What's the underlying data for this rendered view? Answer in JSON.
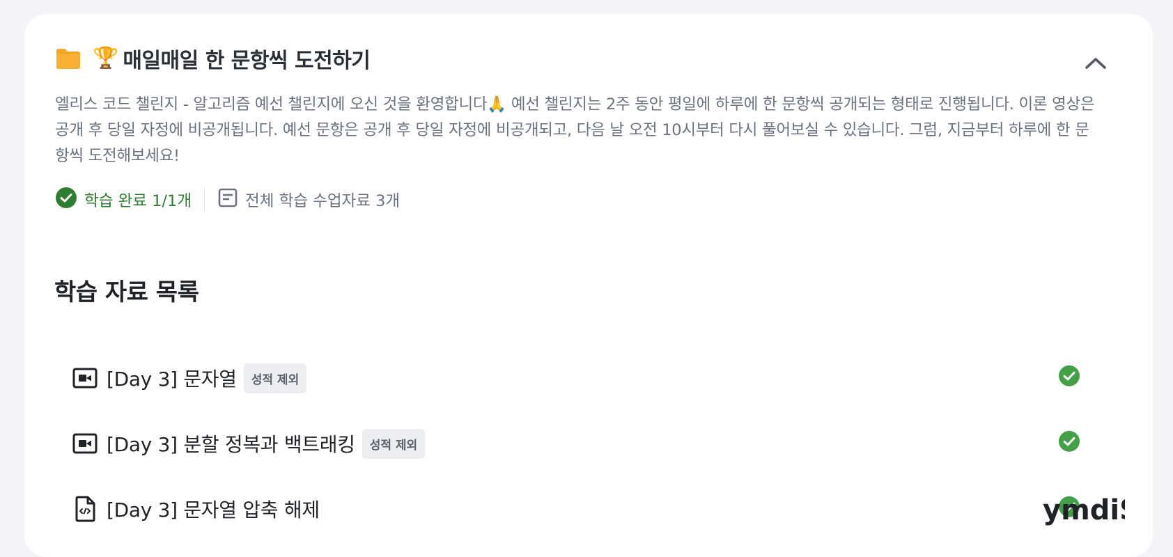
{
  "header": {
    "trophy_emoji": "🏆",
    "title": "매일매일 한 문항씩 도전하기",
    "folder_icon": "folder-icon",
    "collapse_icon": "chevron-up-icon"
  },
  "description": "엘리스 코드 챌린지 - 알고리즘 예선 챌린지에 오신 것을 환영합니다🙏 예선 챌린지는 2주 동안 평일에 하루에 한 문항씩 공개되는 형태로 진행됩니다. 이론 영상은 공개 후 당일 자정에 비공개됩니다. 예선 문항은 공개 후 당일 자정에 비공개되고, 다음 날 오전 10시부터 다시 풀어보실 수 있습니다. 그럼, 지금부터 하루에 한 문항씩 도전해보세요!",
  "meta": {
    "completed_label": "학습 완료 1/1개",
    "total_label": "전체 학습 수업자료 3개"
  },
  "section_title": "학습 자료 목록",
  "items": [
    {
      "label": "[Day 3] 문자열",
      "badge": "성적 제외",
      "icon": "video-icon",
      "completed": true
    },
    {
      "label": "[Day 3] 분할 정복과 백트래킹",
      "badge": "성적 제외",
      "icon": "video-icon",
      "completed": true
    },
    {
      "label": "[Day 3] 문자열 압축 해제",
      "badge": "",
      "icon": "code-file-icon",
      "completed": true
    }
  ],
  "watermark": "ymdiS",
  "colors": {
    "background": "#f3f4f8",
    "card": "#ffffff",
    "success": "#2e7d32",
    "check": "#43a047",
    "folder": "#f5a623",
    "muted_text": "#6b7280"
  }
}
